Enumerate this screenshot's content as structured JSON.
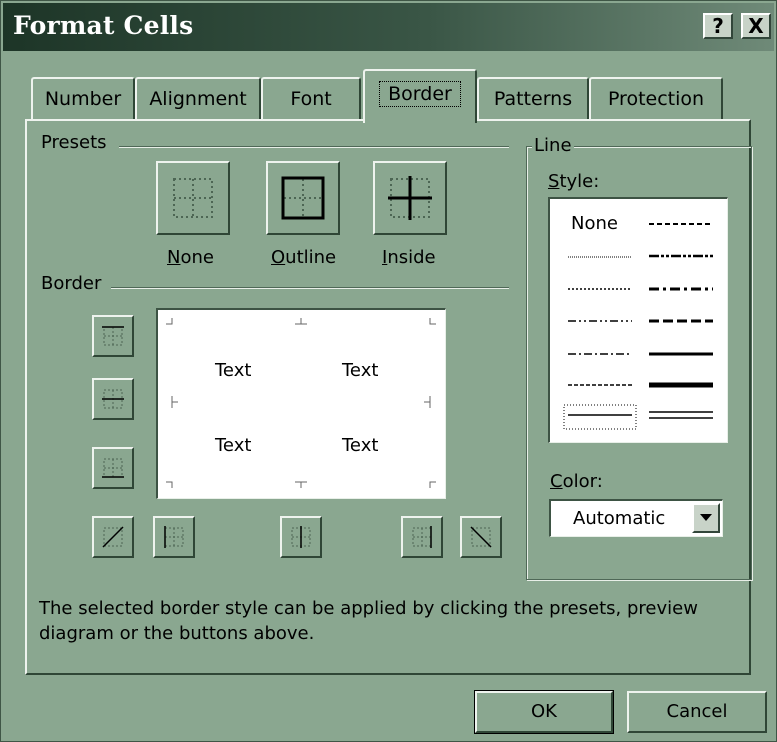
{
  "window": {
    "title": "Format Cells",
    "help_glyph": "?",
    "close_glyph": "X"
  },
  "tabs": [
    {
      "label": "Number"
    },
    {
      "label": "Alignment"
    },
    {
      "label": "Font"
    },
    {
      "label": "Border",
      "active": true
    },
    {
      "label": "Patterns"
    },
    {
      "label": "Protection"
    }
  ],
  "presets": {
    "group_label": "Presets",
    "none": {
      "mnemonic": "N",
      "rest": "one"
    },
    "outline": {
      "mnemonic": "O",
      "rest": "utline"
    },
    "inside": {
      "mnemonic": "I",
      "rest": "nside"
    }
  },
  "border": {
    "group_label": "Border",
    "preview_texts": [
      "Text",
      "Text",
      "Text",
      "Text"
    ]
  },
  "line": {
    "group_label": "Line",
    "style_label": {
      "mnemonic": "S",
      "rest": "tyle:"
    },
    "style_none": "None",
    "color_label": {
      "mnemonic": "C",
      "rest": "olor:"
    },
    "color_value": "Automatic"
  },
  "description": "The selected border style can be applied by clicking the presets, preview diagram or the buttons above.",
  "buttons": {
    "ok": "OK",
    "cancel": "Cancel"
  },
  "colors": {
    "dialog_face": "#8aa790",
    "title_gradient_start": "#1d3527",
    "title_text": "#ffffff",
    "field_background": "#ffffff"
  }
}
